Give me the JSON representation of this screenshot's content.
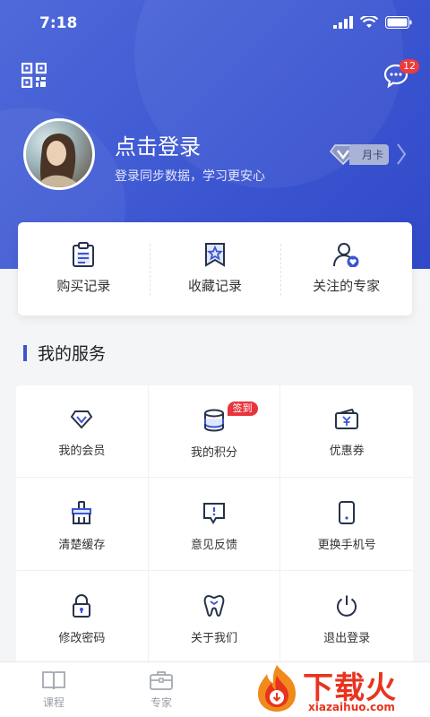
{
  "status_bar": {
    "time": "7:18"
  },
  "header": {
    "message_badge": "12"
  },
  "profile": {
    "title": "点击登录",
    "subtitle": "登录同步数据，学习更安心",
    "vip_tag": "月卡"
  },
  "quick_actions": [
    {
      "label": "购买记录",
      "icon": "clipboard-icon"
    },
    {
      "label": "收藏记录",
      "icon": "bookmark-star-icon"
    },
    {
      "label": "关注的专家",
      "icon": "user-heart-icon"
    }
  ],
  "section_title": "我的服务",
  "services": [
    {
      "label": "我的会员",
      "icon": "diamond-icon"
    },
    {
      "label": "我的积分",
      "icon": "coins-icon",
      "badge": "签到"
    },
    {
      "label": "优惠券",
      "icon": "coupon-icon"
    },
    {
      "label": "清楚缓存",
      "icon": "brush-icon"
    },
    {
      "label": "意见反馈",
      "icon": "feedback-icon"
    },
    {
      "label": "更换手机号",
      "icon": "phone-icon"
    },
    {
      "label": "修改密码",
      "icon": "lock-icon"
    },
    {
      "label": "关于我们",
      "icon": "tooth-icon"
    },
    {
      "label": "退出登录",
      "icon": "power-icon"
    }
  ],
  "tabbar": [
    {
      "label": "课程",
      "icon": "book-icon"
    },
    {
      "label": "专家",
      "icon": "briefcase-icon"
    }
  ],
  "watermark": {
    "title": "下载火",
    "url": "xiazaihuo.com"
  },
  "colors": {
    "primary": "#3b55d1",
    "badge": "#ee3b3b",
    "watermark": "#e8331e"
  }
}
